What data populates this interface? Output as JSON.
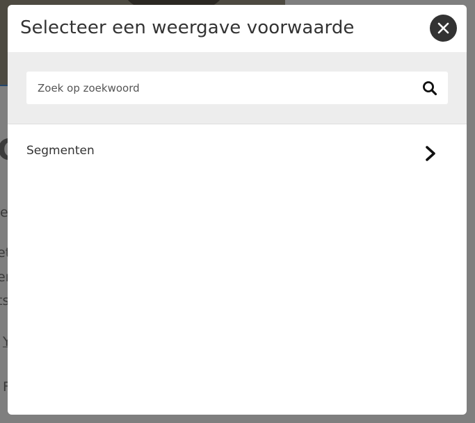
{
  "modal": {
    "title": "Selecteer een weergave voorwaarde",
    "close_icon": "close-icon",
    "search": {
      "placeholder": "Zoek op zoekwoord",
      "value": "",
      "icon": "search-icon"
    },
    "items": [
      {
        "label": "Segmenten",
        "icon": "chevron-right-icon"
      }
    ]
  },
  "background": {
    "fragments": [
      "C",
      "e",
      "et",
      "er",
      "ts",
      "Y",
      "F"
    ]
  },
  "colors": {
    "overlay": "#7f7f7f",
    "modal_bg": "#ffffff",
    "search_band": "#ededed",
    "text": "#333333",
    "close_button": "#333333",
    "page_accent_line": "#24466b"
  }
}
